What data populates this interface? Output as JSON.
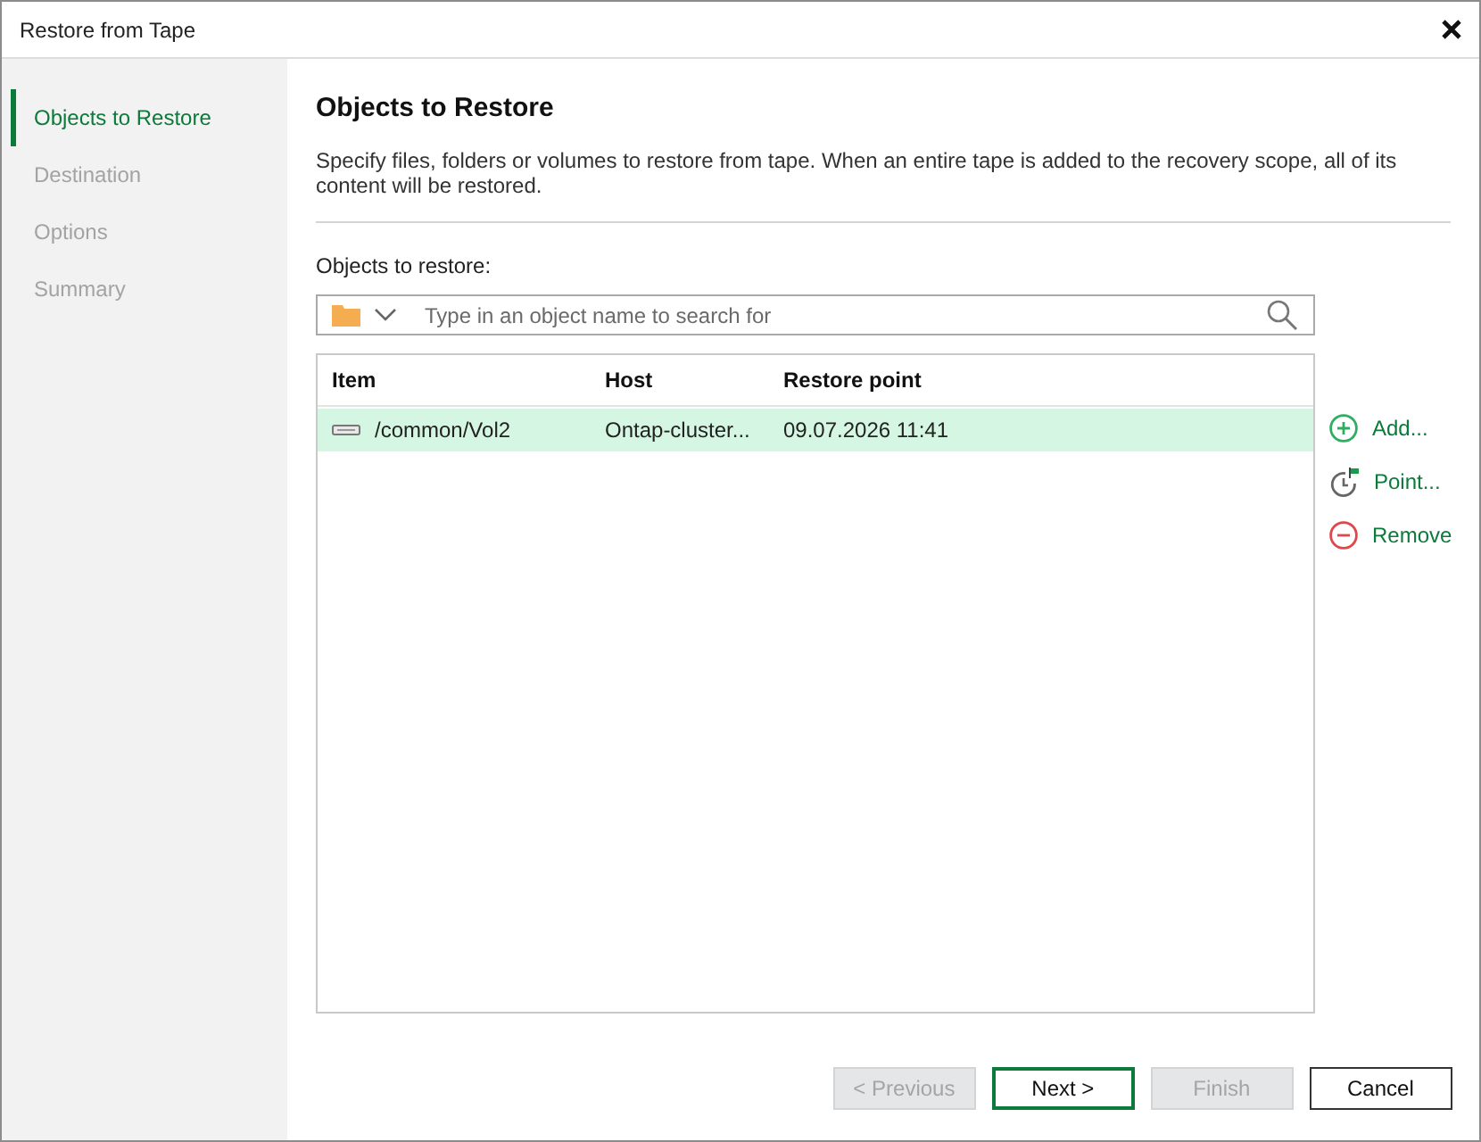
{
  "window": {
    "title": "Restore from Tape"
  },
  "sidebar": {
    "items": [
      {
        "label": "Objects to Restore",
        "selected": true
      },
      {
        "label": "Destination",
        "selected": false
      },
      {
        "label": "Options",
        "selected": false
      },
      {
        "label": "Summary",
        "selected": false
      }
    ]
  },
  "page": {
    "title": "Objects to Restore",
    "description": "Specify files, folders or volumes to restore from tape. When an entire tape is added to the recovery scope, all of its content will be restored."
  },
  "objects": {
    "label": "Objects to restore:",
    "search": {
      "placeholder": "Type in an object name to search for"
    },
    "table": {
      "columns": [
        "Item",
        "Host",
        "Restore point"
      ],
      "rows": [
        {
          "cells": [
            "/common/Vol2",
            "Ontap-cluster...",
            "09.07.2026 11:41"
          ],
          "selected": true
        }
      ]
    }
  },
  "actions": [
    {
      "kind": "add",
      "label": "Add..."
    },
    {
      "kind": "point",
      "label": "Point..."
    },
    {
      "kind": "remove",
      "label": "Remove"
    }
  ],
  "buttons": [
    {
      "label": "< Previous",
      "disabled": true,
      "default": false
    },
    {
      "label": "Next >",
      "disabled": false,
      "default": true
    },
    {
      "label": "Finish",
      "disabled": true,
      "default": false
    },
    {
      "label": "Cancel",
      "disabled": false,
      "default": false
    }
  ]
}
